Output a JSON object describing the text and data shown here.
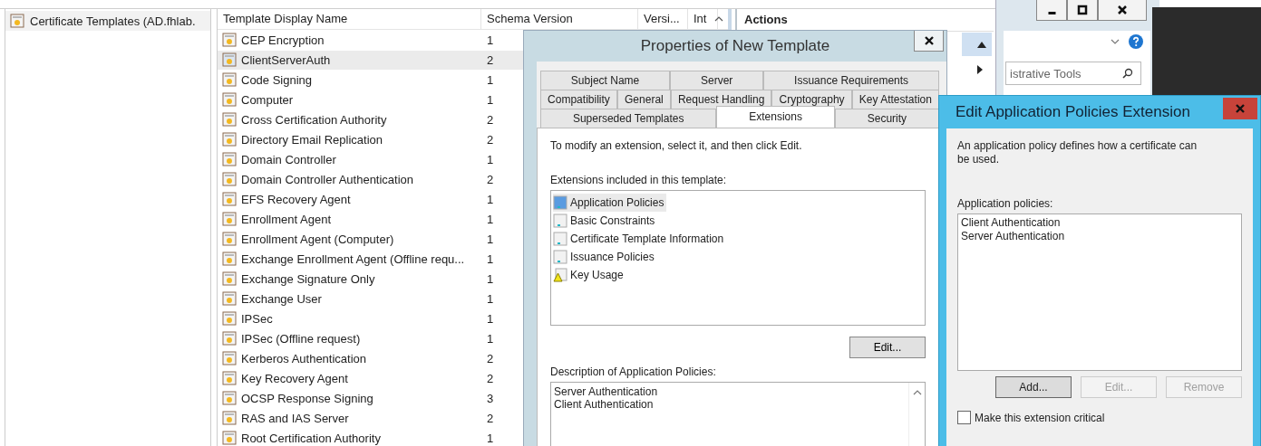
{
  "tree": {
    "items": [
      {
        "label": "Certificate Templates (AD.fhlab.",
        "selected": true
      }
    ]
  },
  "template_list": {
    "columns": [
      "Template Display Name",
      "Schema Version",
      "Versi...",
      "Int"
    ],
    "rows": [
      {
        "name": "CEP Encryption",
        "schema_version": "1",
        "selected": false
      },
      {
        "name": "ClientServerAuth",
        "schema_version": "2",
        "selected": true
      },
      {
        "name": "Code Signing",
        "schema_version": "1",
        "selected": false
      },
      {
        "name": "Computer",
        "schema_version": "1",
        "selected": false
      },
      {
        "name": "Cross Certification Authority",
        "schema_version": "2",
        "selected": false
      },
      {
        "name": "Directory Email Replication",
        "schema_version": "2",
        "selected": false
      },
      {
        "name": "Domain Controller",
        "schema_version": "1",
        "selected": false
      },
      {
        "name": "Domain Controller Authentication",
        "schema_version": "2",
        "selected": false
      },
      {
        "name": "EFS Recovery Agent",
        "schema_version": "1",
        "selected": false
      },
      {
        "name": "Enrollment Agent",
        "schema_version": "1",
        "selected": false
      },
      {
        "name": "Enrollment Agent (Computer)",
        "schema_version": "1",
        "selected": false
      },
      {
        "name": "Exchange Enrollment Agent (Offline requ...",
        "schema_version": "1",
        "selected": false
      },
      {
        "name": "Exchange Signature Only",
        "schema_version": "1",
        "selected": false
      },
      {
        "name": "Exchange User",
        "schema_version": "1",
        "selected": false
      },
      {
        "name": "IPSec",
        "schema_version": "1",
        "selected": false
      },
      {
        "name": "IPSec (Offline request)",
        "schema_version": "1",
        "selected": false
      },
      {
        "name": "Kerberos Authentication",
        "schema_version": "2",
        "selected": false
      },
      {
        "name": "Key Recovery Agent",
        "schema_version": "2",
        "selected": false
      },
      {
        "name": "OCSP Response Signing",
        "schema_version": "3",
        "selected": false
      },
      {
        "name": "RAS and IAS Server",
        "schema_version": "2",
        "selected": false
      },
      {
        "name": "Root Certification Authority",
        "schema_version": "1",
        "selected": false
      }
    ]
  },
  "actions_pane": {
    "title": "Actions"
  },
  "explorer": {
    "search": {
      "value": "istrative Tools"
    }
  },
  "properties_dialog": {
    "title": "Properties of New Template",
    "tab_rows": [
      [
        {
          "label": "Subject Name",
          "selected": false
        },
        {
          "label": "Server",
          "selected": false
        },
        {
          "label": "Issuance Requirements",
          "selected": false
        }
      ],
      [
        {
          "label": "Compatibility",
          "selected": false
        },
        {
          "label": "General",
          "selected": false
        },
        {
          "label": "Request Handling",
          "selected": false
        },
        {
          "label": "Cryptography",
          "selected": false
        },
        {
          "label": "Key Attestation",
          "selected": false
        }
      ],
      [
        {
          "label": "Superseded Templates",
          "selected": false
        },
        {
          "label": "Extensions",
          "selected": true
        },
        {
          "label": "Security",
          "selected": false
        }
      ]
    ],
    "instruction": "To modify an extension, select it, and then click Edit.",
    "extensions_label": "Extensions included in this template:",
    "extensions": [
      {
        "label": "Application Policies",
        "kind": "extension",
        "selected": true
      },
      {
        "label": "Basic Constraints",
        "kind": "extension",
        "selected": false
      },
      {
        "label": "Certificate Template Information",
        "kind": "extension",
        "selected": false
      },
      {
        "label": "Issuance Policies",
        "kind": "extension",
        "selected": false
      },
      {
        "label": "Key Usage",
        "kind": "warning",
        "selected": false
      }
    ],
    "edit_button": "Edit...",
    "description_label": "Description of Application Policies:",
    "description": [
      "Server Authentication",
      "Client Authentication"
    ]
  },
  "edit_dialog": {
    "title": "Edit Application Policies Extension",
    "description": "An application policy defines how a certificate can be used.",
    "policies_label": "Application policies:",
    "policies": [
      "Client Authentication",
      "Server Authentication"
    ],
    "buttons": [
      {
        "label": "Add...",
        "disabled": false
      },
      {
        "label": "Edit...",
        "disabled": true
      },
      {
        "label": "Remove",
        "disabled": true
      }
    ],
    "critical_checkbox": {
      "label": "Make this extension critical",
      "checked": false
    }
  }
}
